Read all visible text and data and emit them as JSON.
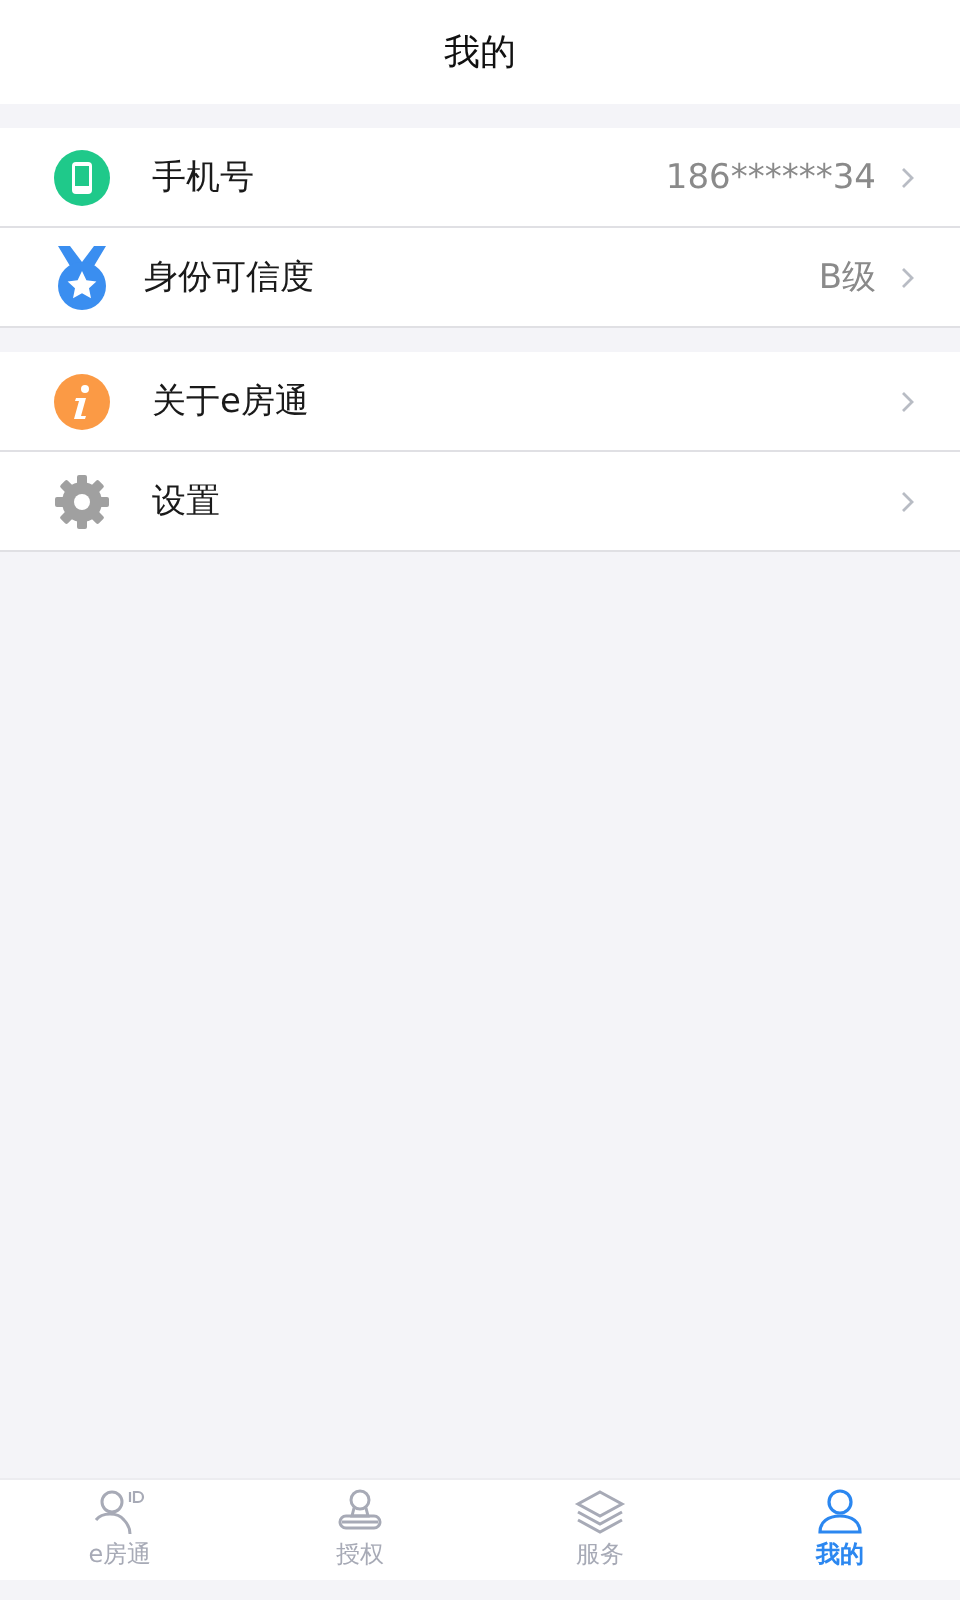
{
  "header": {
    "title": "我的"
  },
  "groups": [
    {
      "rows": [
        {
          "label": "手机号",
          "value": "186******34"
        },
        {
          "label": "身份可信度",
          "value": "B级"
        }
      ]
    },
    {
      "rows": [
        {
          "label": "关于e房通"
        },
        {
          "label": "设置"
        }
      ]
    }
  ],
  "tab_bar": [
    {
      "label": "e房通",
      "selected": false
    },
    {
      "label": "授权",
      "selected": false
    },
    {
      "label": "服务",
      "selected": false
    },
    {
      "label": "我的",
      "selected": true
    }
  ]
}
